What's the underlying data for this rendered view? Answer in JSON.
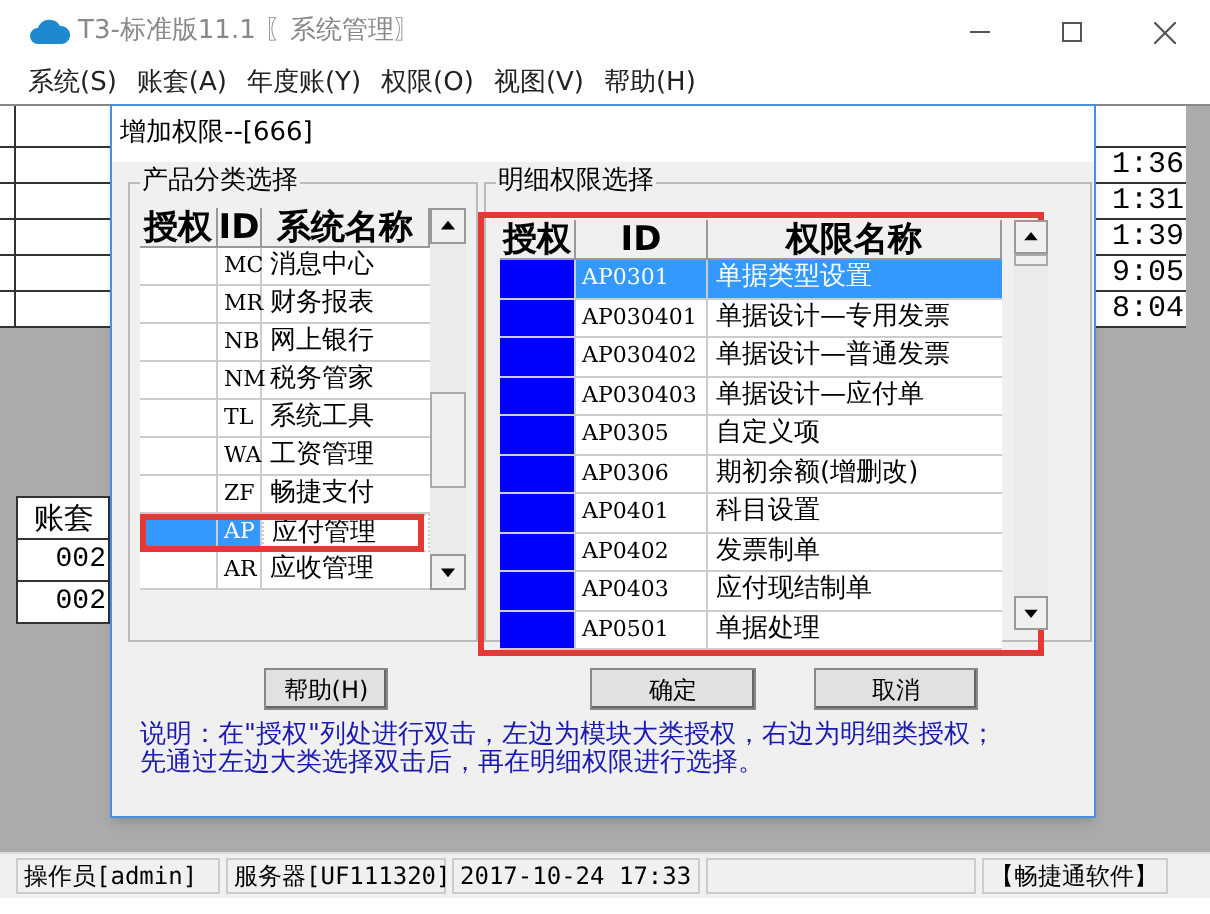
{
  "window": {
    "title": "T3-标准版11.1 〖系统管理〗"
  },
  "menu": [
    "系统(S)",
    "账套(A)",
    "年度账(Y)",
    "权限(O)",
    "视图(V)",
    "帮助(H)"
  ],
  "background_log": {
    "times": [
      "1:36",
      "1:31",
      "1:39",
      "9:05",
      "8:04"
    ]
  },
  "background_accounts": {
    "header": "账套",
    "rows": [
      "002",
      "002"
    ]
  },
  "dialog": {
    "title": "增加权限--[666]",
    "product_group": {
      "title": "产品分类选择",
      "columns": [
        "授权",
        "ID",
        "系统名称"
      ],
      "rows": [
        {
          "id": "MC",
          "name": "消息中心",
          "granted": false,
          "selected": false,
          "annotated": false
        },
        {
          "id": "MR",
          "name": "财务报表",
          "granted": false,
          "selected": false,
          "annotated": false
        },
        {
          "id": "NB",
          "name": "网上银行",
          "granted": false,
          "selected": false,
          "annotated": false
        },
        {
          "id": "NM",
          "name": "税务管家",
          "granted": false,
          "selected": false,
          "annotated": false
        },
        {
          "id": "TL",
          "name": "系统工具",
          "granted": false,
          "selected": false,
          "annotated": false
        },
        {
          "id": "WA",
          "name": "工资管理",
          "granted": false,
          "selected": false,
          "annotated": false
        },
        {
          "id": "ZF",
          "name": "畅捷支付",
          "granted": false,
          "selected": false,
          "annotated": false
        },
        {
          "id": "AP",
          "name": "应付管理",
          "granted": false,
          "selected": true,
          "annotated": true
        },
        {
          "id": "AR",
          "name": "应收管理",
          "granted": false,
          "selected": false,
          "annotated": false
        }
      ]
    },
    "detail_group": {
      "title": "明细权限选择",
      "annotated": true,
      "columns": [
        "授权",
        "ID",
        "权限名称"
      ],
      "rows": [
        {
          "id": "AP0301",
          "name": "单据类型设置",
          "granted": true,
          "selected": true
        },
        {
          "id": "AP030401",
          "name": "单据设计—专用发票",
          "granted": true,
          "selected": false
        },
        {
          "id": "AP030402",
          "name": "单据设计—普通发票",
          "granted": true,
          "selected": false
        },
        {
          "id": "AP030403",
          "name": "单据设计—应付单",
          "granted": true,
          "selected": false
        },
        {
          "id": "AP0305",
          "name": "自定义项",
          "granted": true,
          "selected": false
        },
        {
          "id": "AP0306",
          "name": "期初余额(增删改)",
          "granted": true,
          "selected": false
        },
        {
          "id": "AP0401",
          "name": "科目设置",
          "granted": true,
          "selected": false
        },
        {
          "id": "AP0402",
          "name": "发票制单",
          "granted": true,
          "selected": false
        },
        {
          "id": "AP0403",
          "name": "应付现结制单",
          "granted": true,
          "selected": false
        },
        {
          "id": "AP0501",
          "name": "单据处理",
          "granted": true,
          "selected": false
        }
      ]
    },
    "buttons": [
      "帮助(H)",
      "确定",
      "取消"
    ],
    "note": [
      "说明：在\"授权\"列处进行双击，左边为模块大类授权，右边为明细类授权；",
      "先通过左边大类选择双击后，再在明细权限进行选择。"
    ]
  },
  "status_bar": [
    "操作员[admin]",
    "服务器[UF111320]",
    "2017-10-24 17:33",
    "【畅捷通软件】"
  ]
}
